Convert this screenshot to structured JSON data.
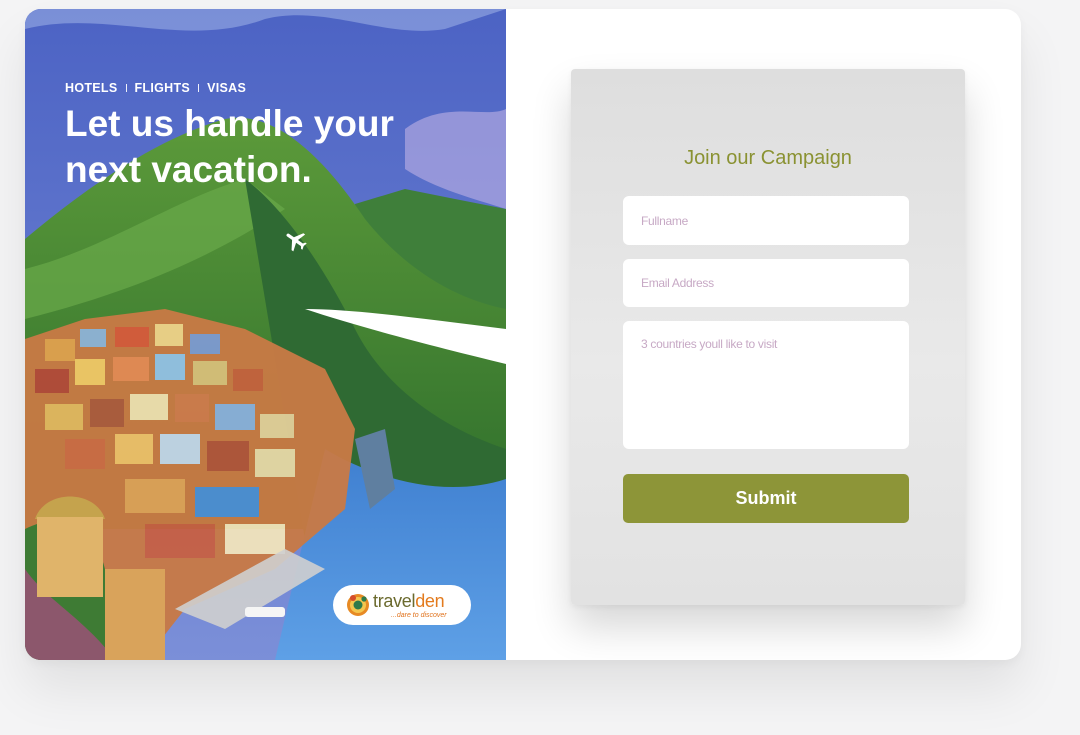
{
  "hero": {
    "nav": [
      "HOTELS",
      "FLIGHTS",
      "VISAS"
    ],
    "headline": "Let us handle your next vacation.",
    "brand": {
      "name_part1": "travel",
      "name_part2": "den",
      "tagline": "...dare to discover"
    }
  },
  "form": {
    "title": "Join our Campaign",
    "fullname_placeholder": "Fullname",
    "email_placeholder": "Email Address",
    "countries_placeholder": "3 countries youll like to visit",
    "submit_label": "Submit"
  },
  "colors": {
    "accent": "#8d9538",
    "title": "#8a9232",
    "placeholder": "#c7a9c5",
    "hero_sky": "#5d7cd0"
  }
}
